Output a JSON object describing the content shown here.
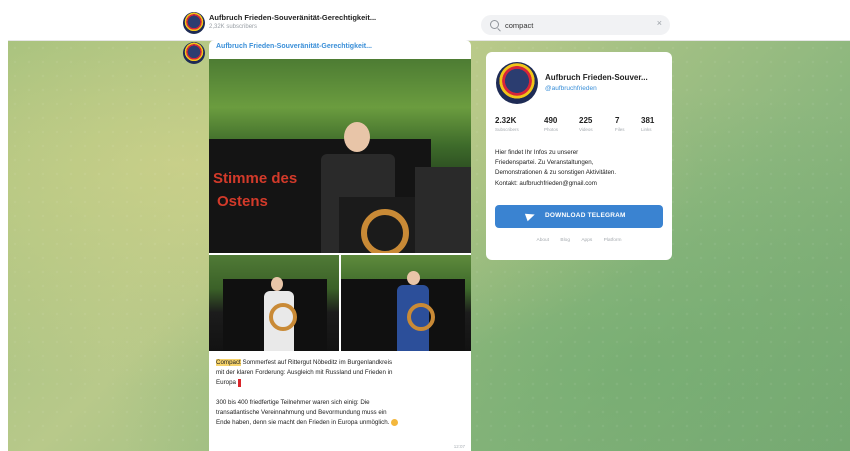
{
  "header": {
    "channel_title": "Aufbruch Frieden-Souveränität-Gerechtigkeit...",
    "subscribers": "2,32K subscribers"
  },
  "search": {
    "value": "compact",
    "clear_icon": "close-icon"
  },
  "post": {
    "author": "Aufbruch Frieden-Souveränität-Gerechtigkeit...",
    "photos": {
      "banner_text_1": "Stimme des",
      "banner_text_2": "Ostens"
    },
    "highlight": "Compact",
    "line1_rest": " Sommerfest auf Rittergut Nöbeditz im Burgenlandkreis",
    "line2": "mit der klaren Forderung: Ausgleich mit Russland und Frieden in",
    "line3": "Europa",
    "para2_line1": "300 bis 400 friedfertige Teilnehmer waren sich einig: Die",
    "para2_line2": "transatlantische Vereinnahmung und Bevormundung muss ein",
    "para2_line3": "Ende haben, denn sie macht den Frieden in Europa unmöglich.",
    "time": "12:07"
  },
  "channel_card": {
    "name": "Aufbruch Frieden-Souver...",
    "handle": "@aufbruchfrieden",
    "stats": [
      {
        "value": "2.32K",
        "label": "Subscribers"
      },
      {
        "value": "490",
        "label": "Photos"
      },
      {
        "value": "225",
        "label": "Videos"
      },
      {
        "value": "7",
        "label": "Files"
      },
      {
        "value": "381",
        "label": "Links"
      }
    ],
    "description": [
      "Hier findet Ihr Infos zu unserer",
      "Friedenspartei. Zu Veranstaltungen,",
      "Demonstrationen & zu sonstigen Aktivitäten.",
      "Kontakt: aufbruchfrieden@gmail.com"
    ],
    "download_label": "DOWNLOAD TELEGRAM",
    "links": [
      "About",
      "Blog",
      "Apps",
      "Platform"
    ]
  },
  "colors": {
    "accent": "#3a83d1",
    "link": "#3a8fd8",
    "highlight": "#f6d36b"
  }
}
